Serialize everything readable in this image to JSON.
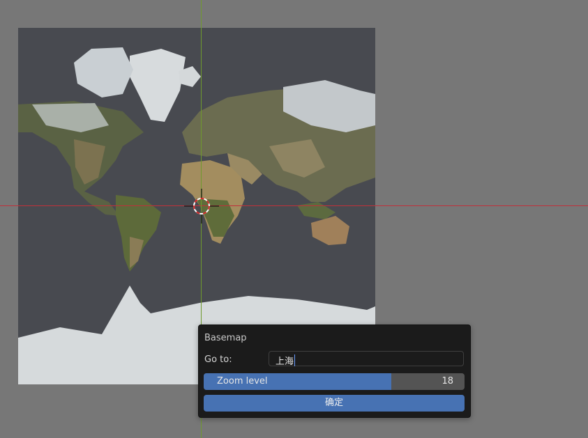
{
  "viewport": {
    "background": "#777777",
    "map_layer": "world-satellite-basemap",
    "x_axis_color": "#c0303a",
    "y_axis_color": "#6f9a2e"
  },
  "panel": {
    "title": "Basemap",
    "goto_label": "Go to:",
    "goto_value": "上海",
    "zoom_label": "Zoom level",
    "zoom_value": "18",
    "zoom_fraction": 0.72,
    "ok_label": "确定",
    "accent": "#4772b3"
  }
}
